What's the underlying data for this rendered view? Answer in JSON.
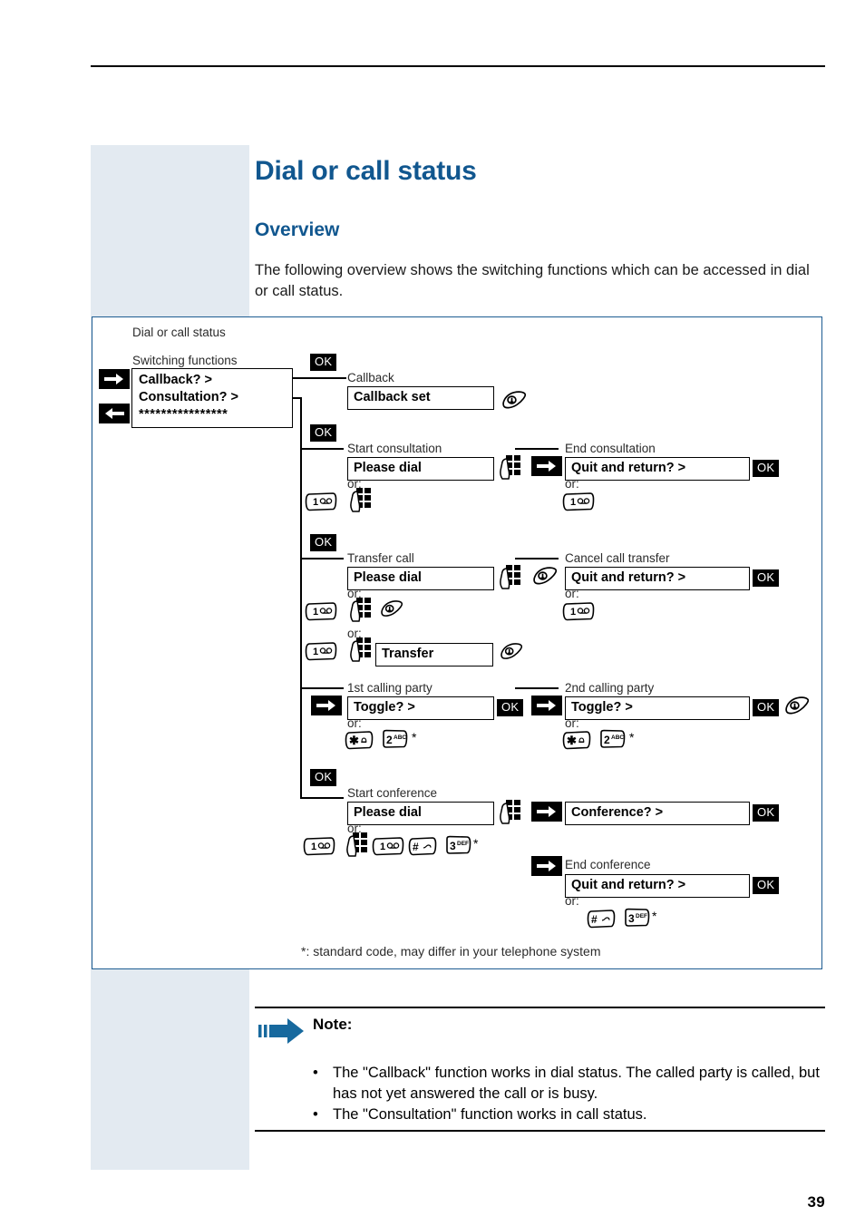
{
  "page": {
    "number": "39",
    "title": "Dial or call status",
    "section_title": "Overview",
    "intro": "The following overview shows the switching functions which can be accessed in dial or call status.",
    "accent_color": "#11578f",
    "sidebar_color": "#e3eaf1",
    "diagram_border_color": "#1d5c92"
  },
  "diagram": {
    "caption_status": "Dial or call status",
    "caption_functions": "Switching functions",
    "menu": {
      "line1": "Callback? >",
      "line2": "Consultation? >",
      "line3": "****************"
    },
    "keys": {
      "ok": "OK",
      "nav_right": "nav-right-arrow",
      "nav_left": "nav-left-arrow",
      "handset_off": "handset-hangup-icon",
      "keypad": "keypad-dial-icon",
      "key_1": "key-1-voicemail-icon",
      "key_star": "key-star-bell-icon",
      "key_hash": "key-hash-icon",
      "key_2": "key-2-abc-icon",
      "key_3": "key-3-def-icon"
    },
    "key_labels": {
      "one": "1",
      "two": "2",
      "two_sub": "ABC",
      "three": "3",
      "three_sub": "DEF",
      "star": "*",
      "hash": "#",
      "asterisk_mark": "*"
    },
    "branches": [
      {
        "id": "callback",
        "label": "Callback",
        "display": "Callback set"
      },
      {
        "id": "consultation",
        "label": "Start consultation",
        "display": "Please dial",
        "or": "or:",
        "right_label": "End consultation",
        "right_display": "Quit and return? >",
        "right_or": "or:"
      },
      {
        "id": "transfer",
        "label": "Transfer call",
        "display": "Please dial",
        "or": "or:",
        "or2": "or:",
        "transfer_display": "Transfer",
        "right_label": "Cancel call transfer",
        "right_display": "Quit and return? >",
        "right_or": "or:"
      },
      {
        "id": "toggle",
        "label": "1st calling party",
        "display": "Toggle? >",
        "or": "or:",
        "right_label": "2nd calling party",
        "right_display": "Toggle? >",
        "right_or": "or:"
      },
      {
        "id": "conference",
        "label": "Start conference",
        "display": "Please dial",
        "or": "or:",
        "right_display": "Conference? >",
        "end_label": "End conference",
        "end_display": "Quit and return? >",
        "end_or": "or:"
      }
    ],
    "footnote": "*: standard code, may differ in your telephone system"
  },
  "note": {
    "title": "Note:",
    "arrow_icon": "note-arrow-icon",
    "items": [
      "The \"Callback\" function works in dial status. The called party is called, but has not yet answered the call or is busy.",
      "The \"Consultation\" function works in call status."
    ]
  }
}
